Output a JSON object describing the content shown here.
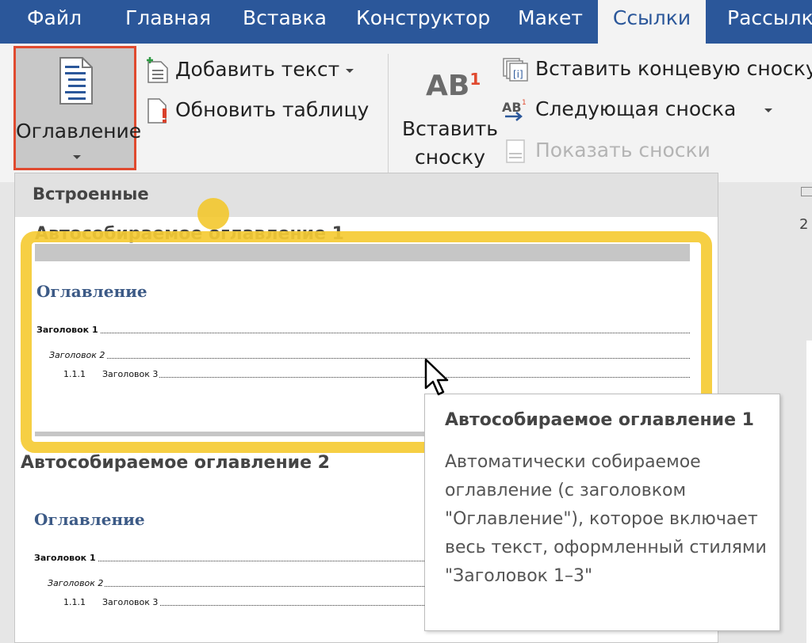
{
  "tabs": [
    {
      "label": "Файл"
    },
    {
      "label": "Главная"
    },
    {
      "label": "Вставка"
    },
    {
      "label": "Конструктор"
    },
    {
      "label": "Макет"
    },
    {
      "label": "Ссылки"
    },
    {
      "label": "Рассылки"
    }
  ],
  "ribbon": {
    "toc_button": {
      "label": "Оглавление",
      "icon": "table-of-contents-icon"
    },
    "add_text": {
      "label": "Добавить текст",
      "icon": "add-text-icon"
    },
    "update_table": {
      "label": "Обновить таблицу",
      "icon": "update-table-icon"
    },
    "insert_footnote": {
      "label_line1": "Вставить",
      "label_line2": "сноску",
      "icon_text": "AB",
      "icon_sup": "1"
    },
    "insert_endnote": {
      "label": "Вставить концевую сноску",
      "icon": "insert-endnote-icon"
    },
    "next_footnote": {
      "label": "Следующая сноска",
      "icon": "next-footnote-icon"
    },
    "show_notes": {
      "label": "Показать сноски",
      "icon": "show-notes-icon"
    }
  },
  "gallery": {
    "section_header": "Встроенные",
    "items": [
      {
        "title": "Автособираемое оглавление 1",
        "preview_heading": "Оглавление",
        "lines": [
          {
            "number": "",
            "text": "Заголовок 1"
          },
          {
            "number": "",
            "text": "Заголовок 2"
          },
          {
            "number": "1.1.1",
            "text": "Заголовок 3"
          }
        ]
      },
      {
        "title": "Автособираемое оглавление 2",
        "preview_heading": "Оглавление",
        "lines": [
          {
            "number": "",
            "text": "Заголовок 1"
          },
          {
            "number": "",
            "text": "Заголовок 2"
          },
          {
            "number": "1.1.1",
            "text": "Заголовок 3"
          }
        ]
      }
    ]
  },
  "tooltip": {
    "title": "Автособираемое оглавление 1",
    "body": "Автоматически собираемое оглавление (с заголовком \"Оглавление\"), которое включает весь текст, оформленный стилями \"Заголовок 1–3\""
  },
  "document": {
    "ruler_number": "2"
  },
  "colors": {
    "tab_bar": "#2b579a",
    "ribbon": "#f3f3f3",
    "selection_border": "#e04a2f",
    "highlight": "#f5cb34",
    "toc_heading": "#3c5a86",
    "footnote_sup": "#e04a2f"
  }
}
